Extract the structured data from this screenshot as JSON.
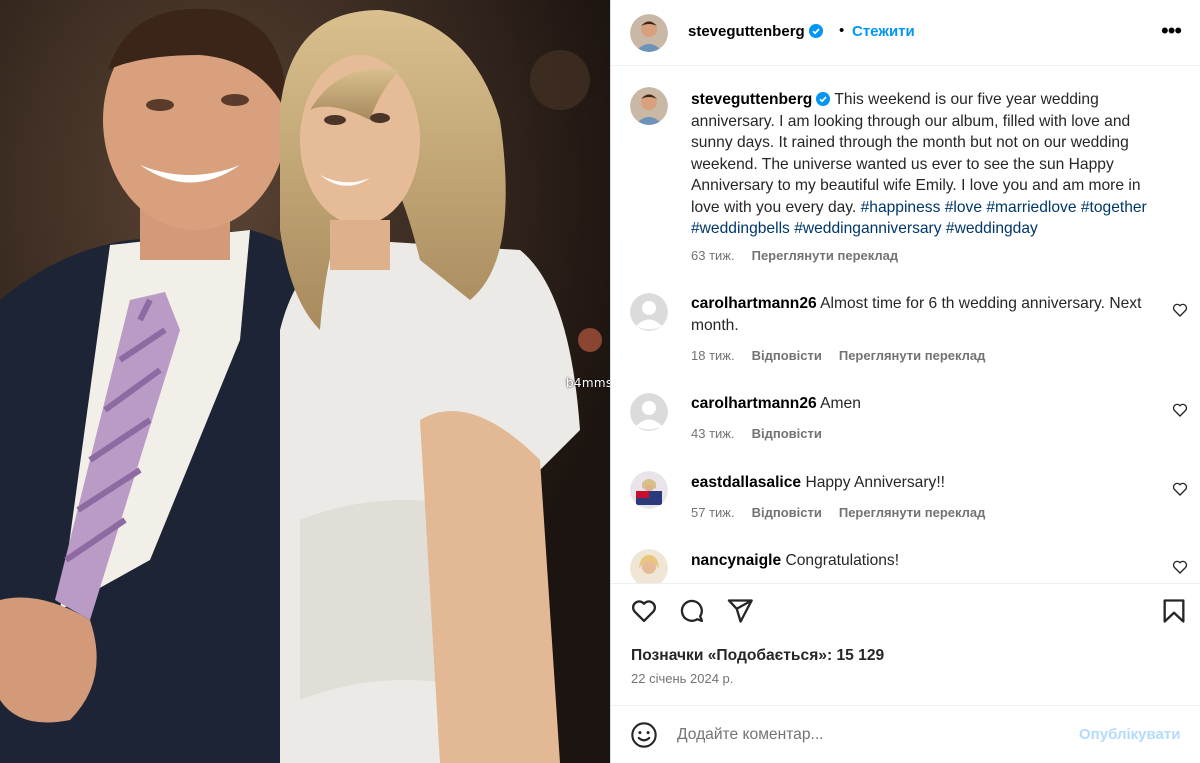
{
  "photo": {
    "watermark": "b4mms"
  },
  "header": {
    "username": "steveguttenberg",
    "separator": "•",
    "follow_label": "Стежити",
    "more_label": "•••"
  },
  "caption": {
    "username": "steveguttenberg",
    "text": "This weekend is our five year wedding anniversary. I am looking through our album, filled with love and sunny days. It rained through the month but not on our wedding weekend. The universe wanted us ever to see the sun Happy Anniversary to my beautiful wife Emily. I love you and am more in love with you every day.",
    "hashtags": [
      "#happiness",
      "#love",
      "#marriedlove",
      "#together",
      "#weddingbells",
      "#weddinganniversary",
      "#weddingday"
    ],
    "time": "63 тиж.",
    "translate_label": "Переглянути переклад"
  },
  "comments": [
    {
      "username": "carolhartmann26",
      "text": "Almost time for 6 th wedding anniversary. Next month.",
      "time": "18 тиж.",
      "reply_label": "Відповісти",
      "translate_label": "Переглянути переклад"
    },
    {
      "username": "carolhartmann26",
      "text": "Amen",
      "time": "43 тиж.",
      "reply_label": "Відповісти",
      "translate_label": ""
    },
    {
      "username": "eastdallasalice",
      "text": "Happy Anniversary!!",
      "time": "57 тиж.",
      "reply_label": "Відповісти",
      "translate_label": "Переглянути переклад"
    },
    {
      "username": "nancynaigle",
      "text": "Congratulations!",
      "time": "",
      "reply_label": "",
      "translate_label": ""
    }
  ],
  "likes_text": "Позначки «Подобається»: 15 129",
  "date_text": "22 січень 2024 р.",
  "add_comment": {
    "placeholder": "Додайте коментар...",
    "publish_label": "Опублікувати"
  },
  "icons": {
    "like": "heart-icon",
    "comment": "comment-bubble-icon",
    "share": "paper-plane-icon",
    "save": "bookmark-icon",
    "emoji": "smiley-icon",
    "verified": "verified-badge-icon",
    "more": "more-options-icon"
  },
  "colors": {
    "link_blue": "#0095f6",
    "hashtag": "#00376b",
    "muted": "#737373",
    "publish_disabled": "#b3dbff",
    "verified": "#0095f6"
  }
}
